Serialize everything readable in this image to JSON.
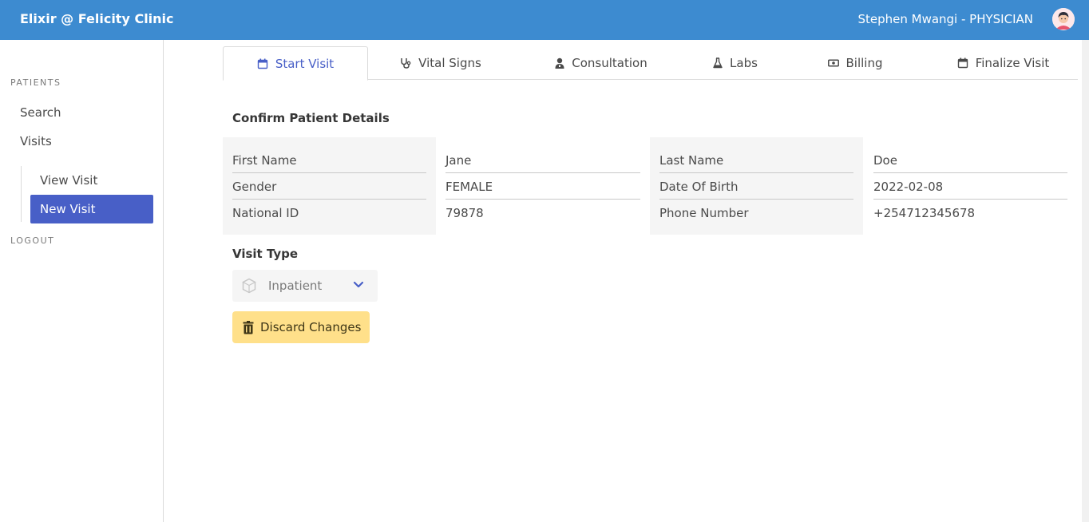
{
  "app": {
    "brand": "Elixir @ Felicity Clinic",
    "user": "Stephen Mwangi - PHYSICIAN"
  },
  "sidebar": {
    "section_label": "PATIENTS",
    "items": [
      {
        "label": "Search"
      },
      {
        "label": "Visits"
      }
    ],
    "sub_items": [
      {
        "label": "View Visit",
        "active": false
      },
      {
        "label": "New Visit",
        "active": true
      }
    ],
    "logout_label": "LOGOUT"
  },
  "tabs": [
    {
      "label": "Start Visit",
      "icon": "calendar-icon",
      "active": true
    },
    {
      "label": "Vital Signs",
      "icon": "stethoscope-icon",
      "active": false
    },
    {
      "label": "Consultation",
      "icon": "doctor-icon",
      "active": false
    },
    {
      "label": "Labs",
      "icon": "flask-icon",
      "active": false
    },
    {
      "label": "Billing",
      "icon": "money-icon",
      "active": false
    },
    {
      "label": "Finalize Visit",
      "icon": "calendar-check-icon",
      "active": false
    }
  ],
  "patient": {
    "title": "Confirm Patient Details",
    "rows": [
      {
        "label1": "First Name",
        "value1": "Jane",
        "label2": "Last Name",
        "value2": "Doe"
      },
      {
        "label1": "Gender",
        "value1": "FEMALE",
        "label2": "Date Of Birth",
        "value2": "2022-02-08"
      },
      {
        "label1": "National ID",
        "value1": "79878",
        "label2": "Phone Number",
        "value2": "+254712345678"
      }
    ]
  },
  "visit": {
    "title": "Visit Type",
    "selected": "Inpatient",
    "icon": "cube-icon"
  },
  "actions": {
    "discard_label": "Discard Changes",
    "discard_icon": "trash-icon"
  },
  "colors": {
    "navbar": "#3d8bd0",
    "active": "#485fc7",
    "warning": "#ffe08a"
  }
}
